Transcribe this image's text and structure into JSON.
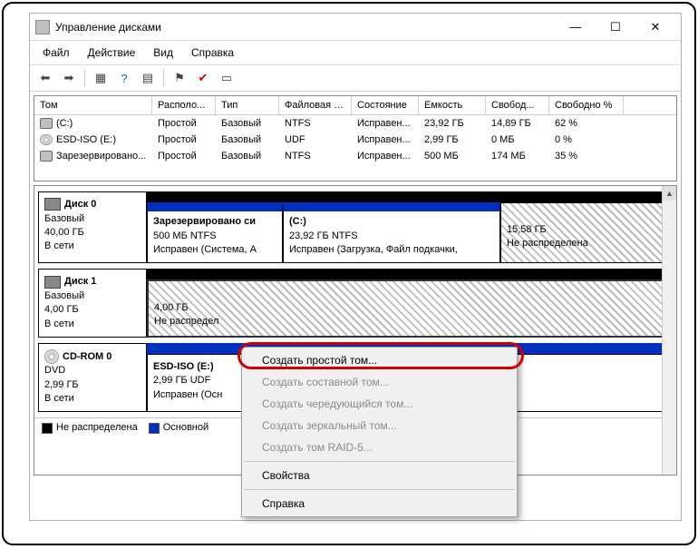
{
  "titlebar": {
    "title": "Управление дисками"
  },
  "window_controls": {
    "minimize": "—",
    "maximize": "☐",
    "close": "✕"
  },
  "menubar": [
    "Файл",
    "Действие",
    "Вид",
    "Справка"
  ],
  "columns": [
    "Том",
    "Располо...",
    "Тип",
    "Файловая с...",
    "Состояние",
    "Емкость",
    "Свобод...",
    "Свободно %"
  ],
  "volumes": [
    {
      "icon": "drive",
      "name": "(C:)",
      "layout": "Простой",
      "type": "Базовый",
      "fs": "NTFS",
      "status": "Исправен...",
      "capacity": "23,92 ГБ",
      "free": "14,89 ГБ",
      "freepct": "62 %"
    },
    {
      "icon": "cd",
      "name": "ESD-ISO (E:)",
      "layout": "Простой",
      "type": "Базовый",
      "fs": "UDF",
      "status": "Исправен...",
      "capacity": "2,99 ГБ",
      "free": "0 МБ",
      "freepct": "0 %"
    },
    {
      "icon": "drive",
      "name": "Зарезервировано...",
      "layout": "Простой",
      "type": "Базовый",
      "fs": "NTFS",
      "status": "Исправен...",
      "capacity": "500 МБ",
      "free": "174 МБ",
      "freepct": "35 %"
    }
  ],
  "disks": {
    "d0": {
      "label": "Диск 0",
      "type": "Базовый",
      "size": "40,00 ГБ",
      "status": "В сети",
      "p0": {
        "title": "Зарезервировано си",
        "size": "500 МБ NTFS",
        "status": "Исправен (Система, А"
      },
      "p1": {
        "title": "(C:)",
        "size": "23,92 ГБ NTFS",
        "status": "Исправен (Загрузка, Файл подкачки,"
      },
      "p2": {
        "title": "",
        "size": "15,58 ГБ",
        "status": "Не распределена"
      }
    },
    "d1": {
      "label": "Диск 1",
      "type": "Базовый",
      "size": "4,00 ГБ",
      "status": "В сети",
      "p0": {
        "size": "4,00 ГБ",
        "status": "Не распредел"
      }
    },
    "d2": {
      "label": "CD-ROM 0",
      "type": "DVD",
      "size": "2,99 ГБ",
      "status": "В сети",
      "p0": {
        "title": "ESD-ISO  (E:)",
        "size": "2,99 ГБ UDF",
        "status": "Исправен (Осн"
      }
    }
  },
  "legend": {
    "unallocated": "Не распределена",
    "primary": "Основной"
  },
  "context_menu": {
    "create_simple": "Создать простой том...",
    "create_spanned": "Создать составной том...",
    "create_striped": "Создать чередующийся том...",
    "create_mirrored": "Создать зеркальный том...",
    "create_raid5": "Создать том RAID-5...",
    "properties": "Свойства",
    "help": "Справка"
  }
}
